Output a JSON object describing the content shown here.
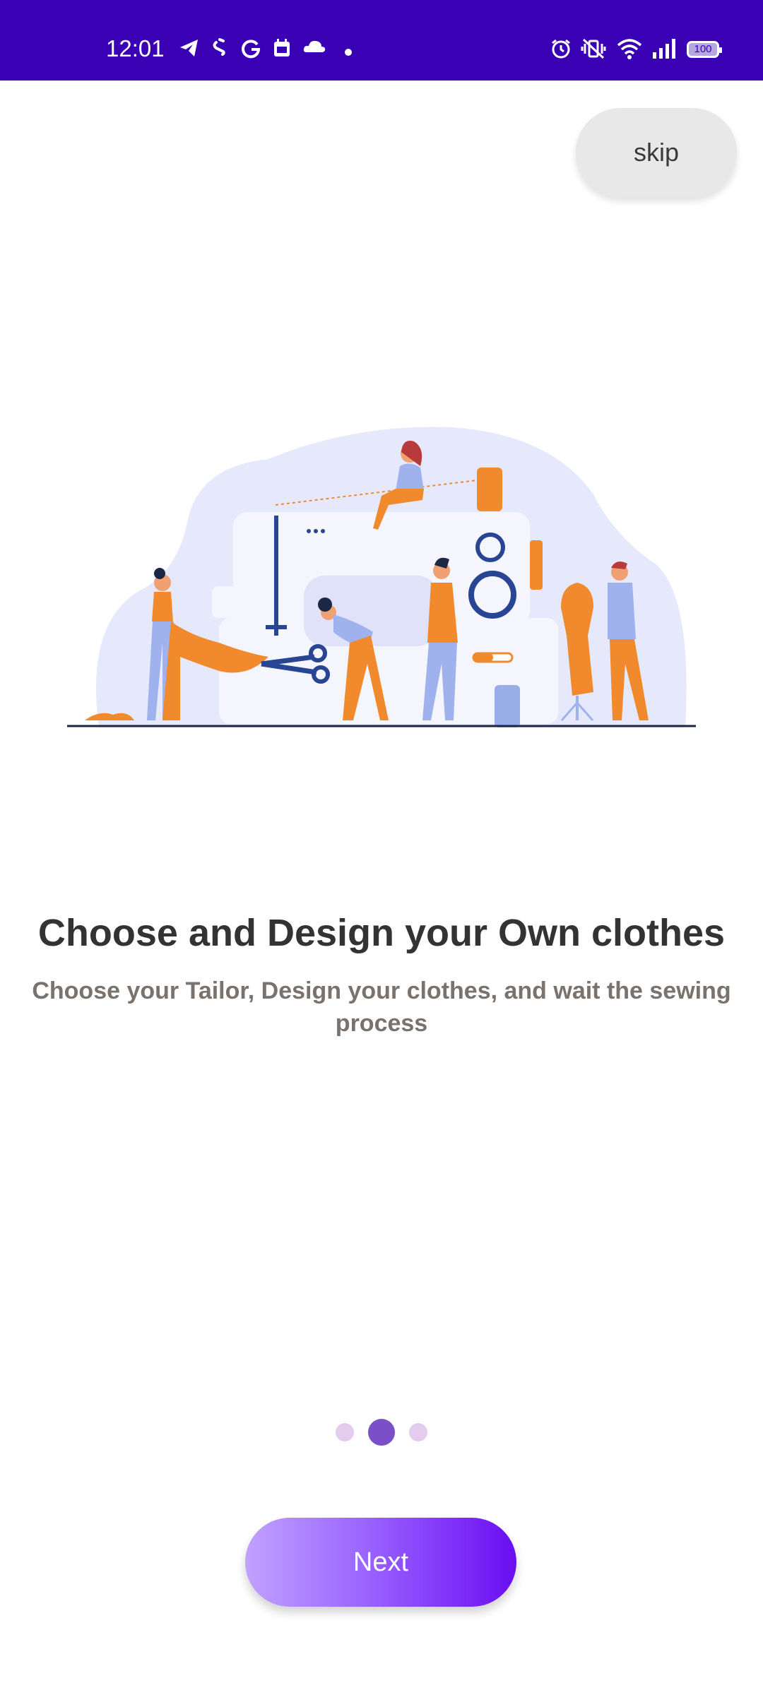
{
  "status_bar": {
    "time": "12:01",
    "battery": "100",
    "left_icons": [
      "telegram-icon",
      "shazam-icon",
      "grammarly-icon",
      "calendar-icon",
      "cloud-icon",
      "dot-icon"
    ],
    "right_icons": [
      "alarm-icon",
      "vibrate-off-icon",
      "wifi-icon",
      "signal-icon",
      "battery-icon"
    ],
    "background_color": "#3a00b3"
  },
  "skip_label": "skip",
  "onboarding": {
    "title": "Choose and Design your Own clothes",
    "subtitle": "Choose your Tailor, Design your clothes, and wait the sewing process",
    "illustration": "tailors-sewing-machine-illustration"
  },
  "page_indicator": {
    "count": 3,
    "active_index": 1,
    "active_color": "#7a4fc7",
    "inactive_color": "#e4ccef"
  },
  "next_label": "Next",
  "colors": {
    "accent_start": "#c0a2ff",
    "accent_end": "#6a0df2"
  }
}
